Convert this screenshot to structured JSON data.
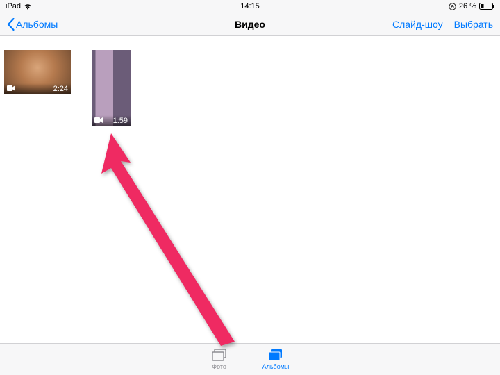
{
  "statusbar": {
    "device": "iPad",
    "time": "14:15",
    "battery_percent": "26 %"
  },
  "navbar": {
    "back_label": "Альбомы",
    "title": "Видео",
    "slideshow_label": "Слайд-шоу",
    "select_label": "Выбрать"
  },
  "videos": [
    {
      "duration": "2:24",
      "orientation": "landscape"
    },
    {
      "duration": "1:59",
      "orientation": "portrait"
    }
  ],
  "tabbar": {
    "photos_label": "Фото",
    "albums_label": "Альбомы"
  },
  "colors": {
    "tint": "#007aff",
    "annotation": "#ef2a62"
  }
}
